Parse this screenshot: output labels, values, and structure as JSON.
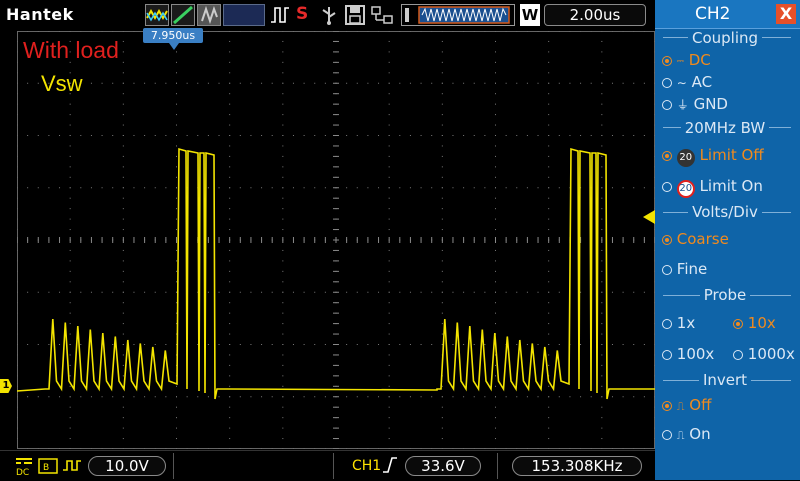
{
  "top_bar": {
    "brand": "Hantek",
    "trigger_mode": "S",
    "timebase": "2.00us",
    "mode_letter": "W"
  },
  "screen": {
    "trigger_position": "7.950us",
    "annotation_title": "With load",
    "annotation_signal": "Vsw",
    "channel_marker": "1"
  },
  "bottom_bar": {
    "volts_div": "10.0V",
    "trigger_source": "CH1",
    "trigger_level": "33.6V",
    "frequency": "153.308KHz"
  },
  "panel": {
    "title": "CH2",
    "close": "X",
    "coupling": {
      "title": "Coupling",
      "options": [
        {
          "label": "DC",
          "selected": true
        },
        {
          "label": "AC",
          "selected": false
        },
        {
          "label": "GND",
          "selected": false
        }
      ]
    },
    "bandwidth": {
      "title": "20MHz BW",
      "options": [
        {
          "label": "Limit Off",
          "selected": true
        },
        {
          "label": "Limit On",
          "selected": false
        }
      ]
    },
    "volts_div": {
      "title": "Volts/Div",
      "options": [
        {
          "label": "Coarse",
          "selected": true
        },
        {
          "label": "Fine",
          "selected": false
        }
      ]
    },
    "probe": {
      "title": "Probe",
      "options": [
        {
          "label": "1x",
          "selected": false
        },
        {
          "label": "10x",
          "selected": true
        },
        {
          "label": "100x",
          "selected": false
        },
        {
          "label": "1000x",
          "selected": false
        }
      ]
    },
    "invert": {
      "title": "Invert",
      "options": [
        {
          "label": "Off",
          "selected": true
        },
        {
          "label": "On",
          "selected": false
        }
      ]
    }
  },
  "colors": {
    "trace": "#f3e400",
    "panel_bg": "#0f64a8",
    "selected": "#f08a1e",
    "annotation_red": "#e0201e"
  }
}
